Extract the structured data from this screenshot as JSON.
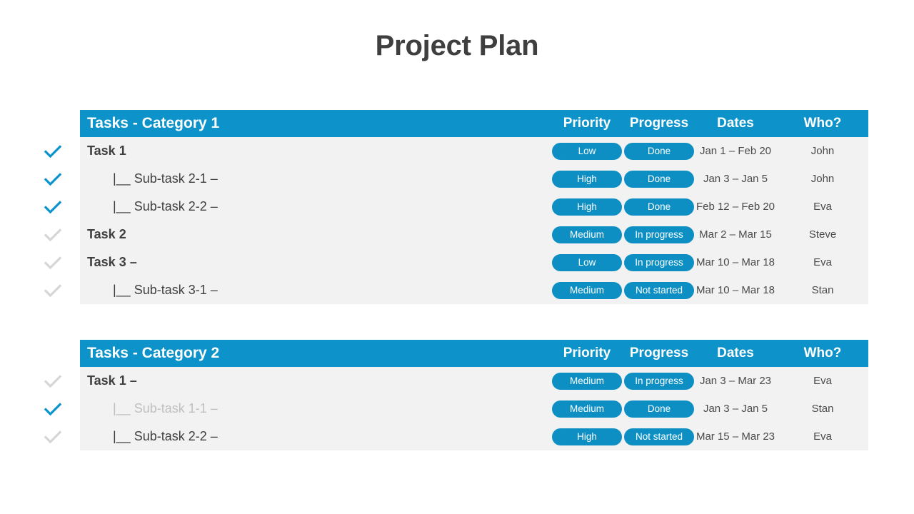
{
  "title": "Project Plan",
  "colors": {
    "header_blue": "#0d93c9",
    "badge_blue": "#0d8fc4",
    "check_on": "#0b93cc",
    "check_off": "#d6d6d6",
    "row_bg": "#f2f2f2",
    "title_text": "#3f3f3f"
  },
  "columns": [
    "Priority",
    "Progress",
    "Dates",
    "Who?"
  ],
  "tables": [
    {
      "title": "Tasks - Category 1",
      "columns": [
        "Priority",
        "Progress",
        "Dates",
        "Who?"
      ],
      "rows": [
        {
          "checked": true,
          "muted": false,
          "sub": false,
          "task": "Task 1",
          "priority": "Low",
          "progress": "Done",
          "dates": "Jan 1 – Feb 20",
          "who": "John"
        },
        {
          "checked": true,
          "muted": false,
          "sub": true,
          "task": "|__ Sub-task 2-1 –",
          "priority": "High",
          "progress": "Done",
          "dates": "Jan 3 – Jan 5",
          "who": "John"
        },
        {
          "checked": true,
          "muted": false,
          "sub": true,
          "task": "|__ Sub-task 2-2 –",
          "priority": "High",
          "progress": "Done",
          "dates": "Feb 12 – Feb 20",
          "who": "Eva"
        },
        {
          "checked": false,
          "muted": false,
          "sub": false,
          "task": "Task 2",
          "priority": "Medium",
          "progress": "In progress",
          "dates": "Mar 2 – Mar 15",
          "who": "Steve"
        },
        {
          "checked": false,
          "muted": false,
          "sub": false,
          "task": "Task 3 –",
          "priority": "Low",
          "progress": "In progress",
          "dates": "Mar 10 – Mar 18",
          "who": "Eva"
        },
        {
          "checked": false,
          "muted": false,
          "sub": true,
          "task": "|__ Sub-task 3-1 –",
          "priority": "Medium",
          "progress": "Not started",
          "dates": "Mar 10 – Mar 18",
          "who": "Stan"
        }
      ]
    },
    {
      "title": "Tasks - Category 2",
      "columns": [
        "Priority",
        "Progress",
        "Dates",
        "Who?"
      ],
      "rows": [
        {
          "checked": false,
          "muted": false,
          "sub": false,
          "task": "Task 1 –",
          "priority": "Medium",
          "progress": "In progress",
          "dates": "Jan 3 – Mar 23",
          "who": "Eva"
        },
        {
          "checked": true,
          "muted": true,
          "sub": true,
          "task": "|__ Sub-task 1-1 –",
          "priority": "Medium",
          "progress": "Done",
          "dates": "Jan 3 – Jan 5",
          "who": "Stan"
        },
        {
          "checked": false,
          "muted": false,
          "sub": true,
          "task": "|__ Sub-task 2-2 –",
          "priority": "High",
          "progress": "Not started",
          "dates": "Mar 15 – Mar 23",
          "who": "Eva"
        }
      ]
    }
  ]
}
